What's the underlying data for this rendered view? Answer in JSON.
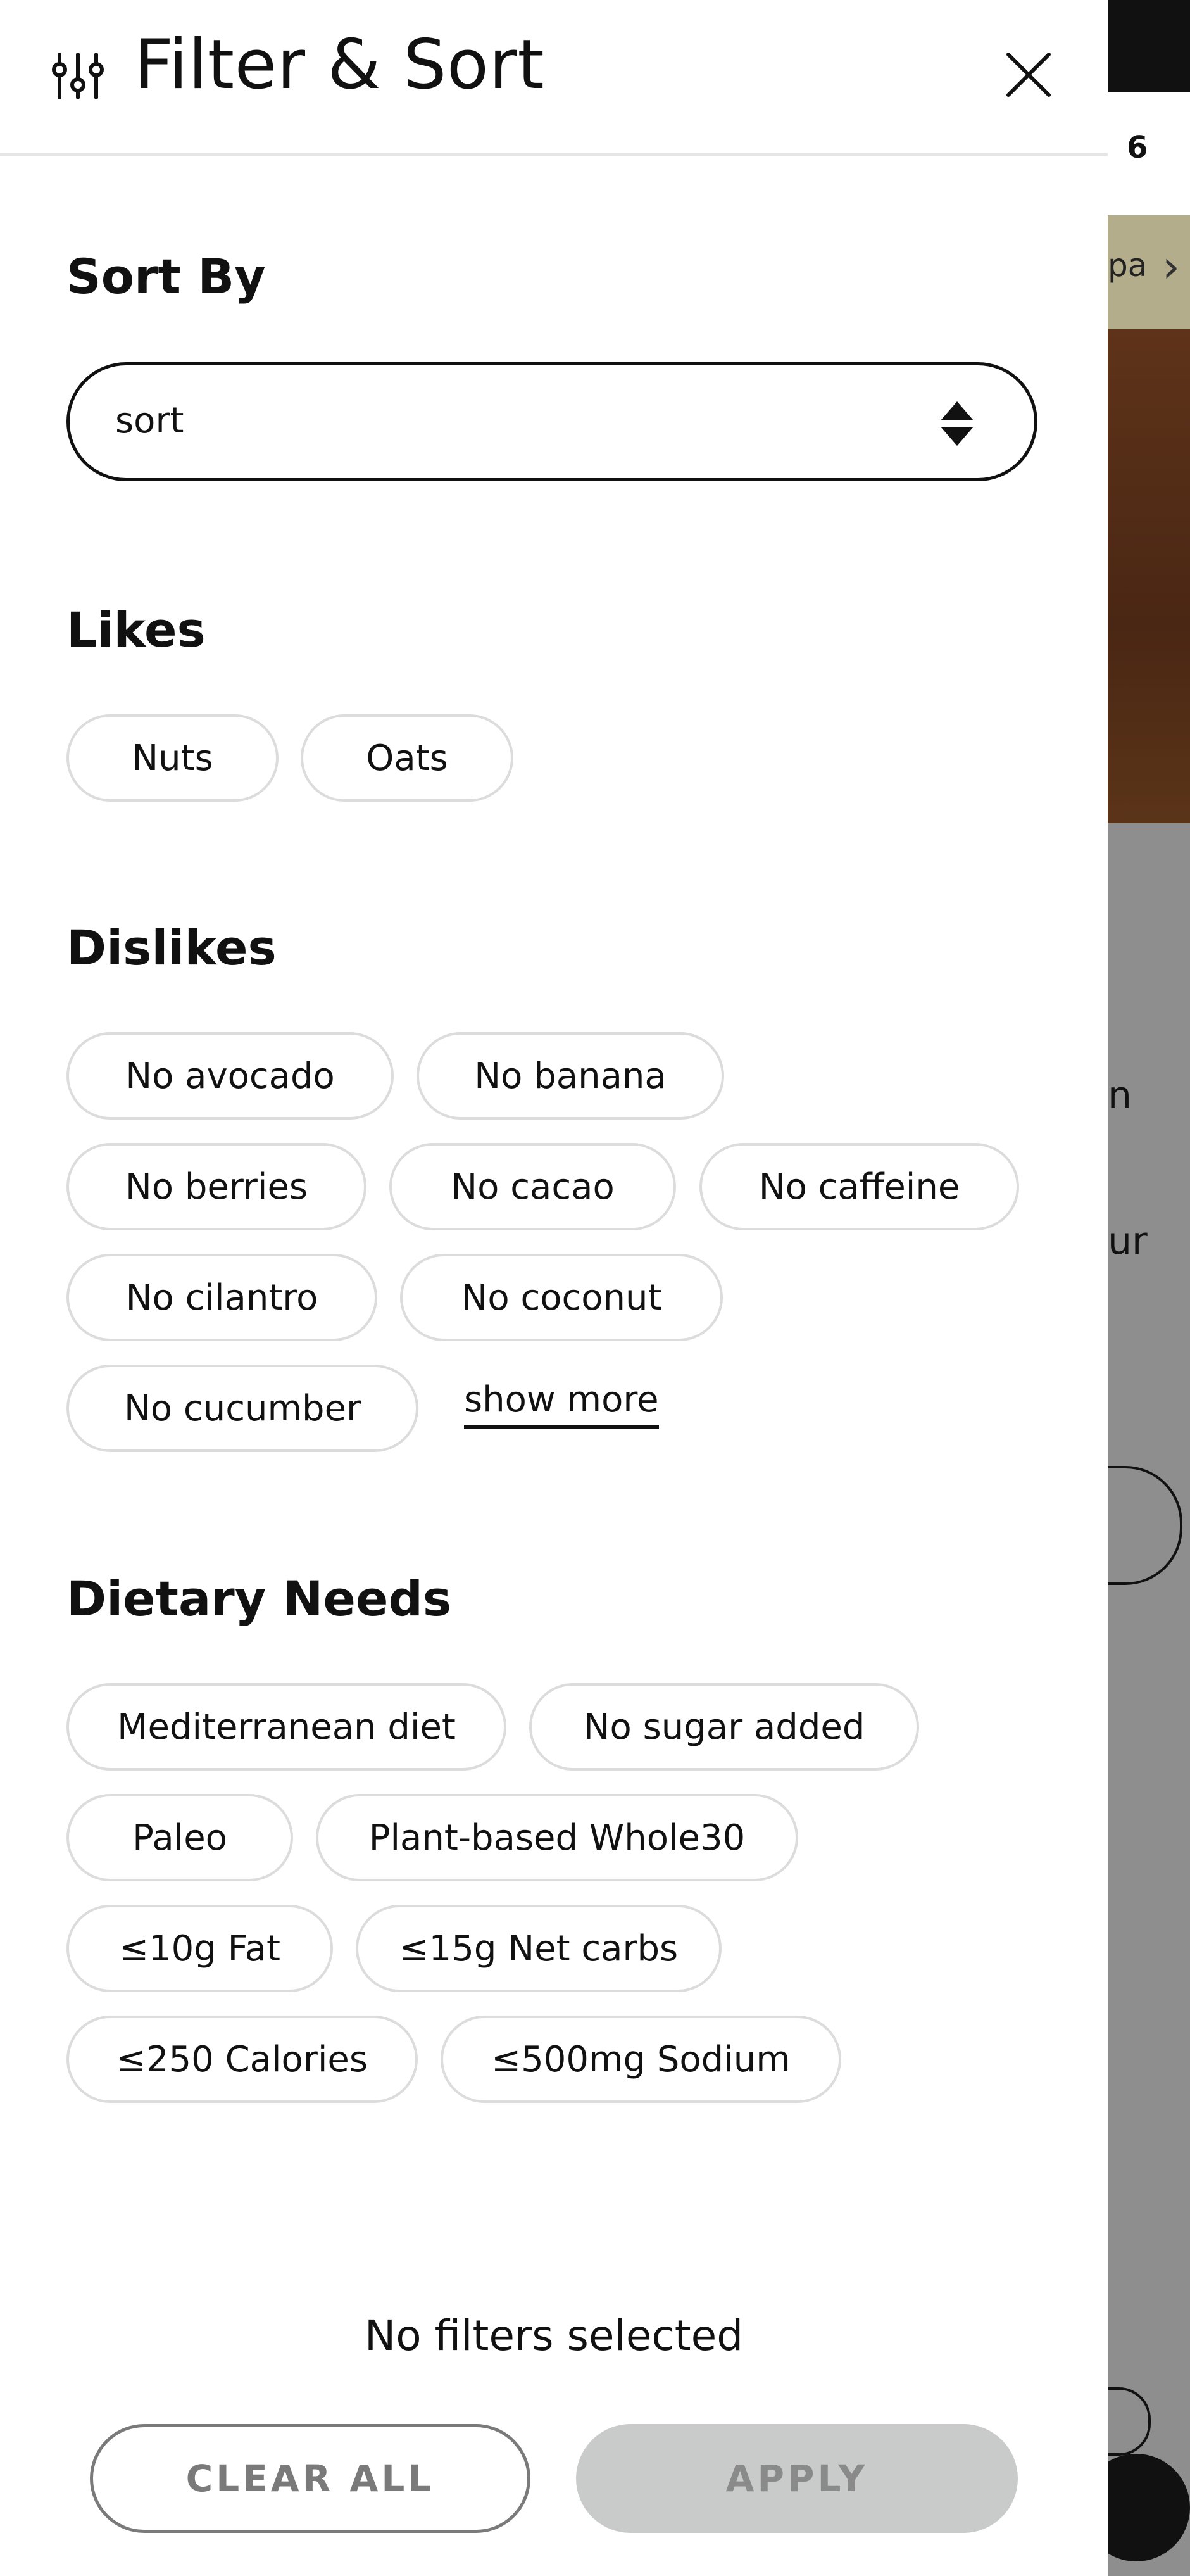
{
  "header": {
    "title": "Filter & Sort",
    "filter_icon": "sliders-icon",
    "close_icon": "close-icon"
  },
  "sort": {
    "title": "Sort By",
    "value": "sort",
    "arrows_icon": "sort-arrows-icon"
  },
  "likes": {
    "title": "Likes",
    "items": [
      "Nuts",
      "Oats"
    ]
  },
  "dislikes": {
    "title": "Dislikes",
    "items": [
      "No avocado",
      "No banana",
      "No berries",
      "No cacao",
      "No caffeine",
      "No cilantro",
      "No coconut",
      "No cucumber"
    ],
    "show_more": "show more"
  },
  "dietary": {
    "title": "Dietary Needs",
    "items": [
      "Mediterranean diet",
      "No sugar added",
      "Paleo",
      "Plant-based Whole30",
      "≤10g Fat",
      "≤15g Net carbs",
      "≤250 Calories",
      "≤500mg Sodium"
    ]
  },
  "footer": {
    "status": "No filters selected",
    "clear_label": "CLEAR ALL",
    "apply_label": "APPLY"
  },
  "background_page": {
    "count_fragment": "6",
    "banner_fragment": "pa",
    "text_fragment_1": "n",
    "text_fragment_2": "ur"
  },
  "colors": {
    "text": "#111111",
    "chip_border": "#dcdcdc",
    "apply_bg": "#c9cbcb",
    "apply_text": "#8a8a8a",
    "clear_border": "#7a7a7a",
    "overlay": "#8e8e8e"
  }
}
